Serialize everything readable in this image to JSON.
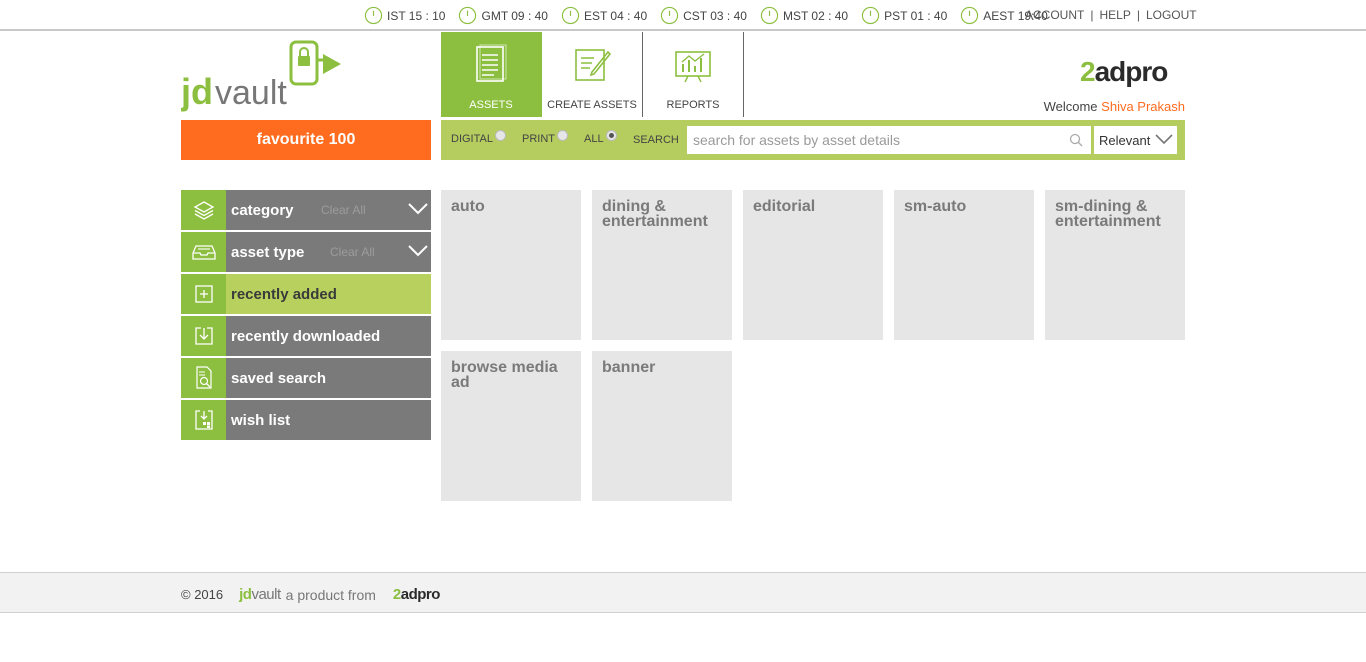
{
  "timezones": [
    {
      "label": "IST 15 : 10"
    },
    {
      "label": "GMT 09 : 40"
    },
    {
      "label": "EST 04 : 40"
    },
    {
      "label": "CST 03 : 40"
    },
    {
      "label": "MST 02 : 40"
    },
    {
      "label": "PST 01 : 40"
    },
    {
      "label": "AEST 19:40"
    }
  ],
  "top_links": {
    "account": "ACCOUNT",
    "help": "HELP",
    "logout": "LOGOUT",
    "separator": "|"
  },
  "logo": {
    "jd": "jd",
    "vault": "vault"
  },
  "favourite_button": "favourite 100",
  "nav_tabs": [
    {
      "label": "ASSETS",
      "icon": "document-list-icon",
      "active": true
    },
    {
      "label": "CREATE ASSETS",
      "icon": "edit-document-icon",
      "active": false
    },
    {
      "label": "REPORTS",
      "icon": "bar-chart-icon",
      "active": false
    }
  ],
  "brand": {
    "two": "2",
    "rest": "adpro"
  },
  "welcome": {
    "prefix": "Welcome",
    "user": "Shiva Prakash"
  },
  "search": {
    "filters": [
      {
        "label": "DIGITAL",
        "checked": false
      },
      {
        "label": "PRINT",
        "checked": false
      },
      {
        "label": "ALL",
        "checked": true
      }
    ],
    "search_label": "SEARCH",
    "placeholder": "search for assets by asset details",
    "sort": "Relevant"
  },
  "sidebar": {
    "clear_all": "Clear All",
    "items": [
      {
        "label": "category",
        "icon": "layers-icon",
        "has_clear": true
      },
      {
        "label": "asset type",
        "icon": "inbox-tray-icon",
        "has_clear": true
      },
      {
        "label": "recently added",
        "icon": "add-box-icon",
        "active": true
      },
      {
        "label": "recently downloaded",
        "icon": "download-box-icon"
      },
      {
        "label": "saved search",
        "icon": "search-document-icon"
      },
      {
        "label": "wish list",
        "icon": "wishlist-icon"
      }
    ]
  },
  "tiles": [
    {
      "line1": "auto",
      "line2": ""
    },
    {
      "line1": "dining &",
      "line2": "entertainment"
    },
    {
      "line1": "editorial",
      "line2": ""
    },
    {
      "line1": "sm-auto",
      "line2": ""
    },
    {
      "line1": "sm-dining &",
      "line2": "entertainment"
    },
    {
      "line1": "browse media",
      "line2": "ad"
    },
    {
      "line1": "banner",
      "line2": ""
    }
  ],
  "footer": {
    "copyright": "© 2016",
    "jd": "jd",
    "vault": "vault",
    "product_from": "a product from",
    "two": "2",
    "adpro": "adpro"
  },
  "colors": {
    "green": "#8cbf3f",
    "light_green": "#b8d15e",
    "orange": "#ff6c1f",
    "sidebar_gray": "#7a7a7a",
    "tile_gray": "#e6e6e6"
  }
}
